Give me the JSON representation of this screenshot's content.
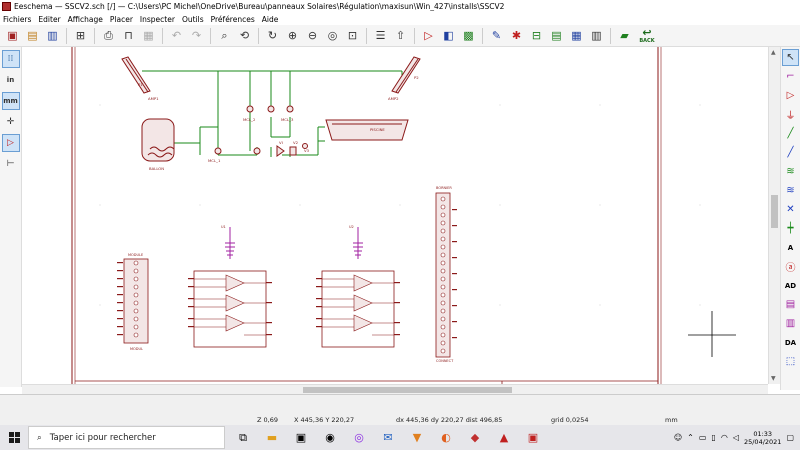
{
  "window": {
    "title": "Eeschema — SSCV2.sch [/] — C:\\Users\\PC Michel\\OneDrive\\Bureau\\panneaux Solaires\\Régulation\\maxisun\\Win_427\\installs\\SSCV2"
  },
  "menu": [
    "Fichiers",
    "Editer",
    "Affichage",
    "Placer",
    "Inspecter",
    "Outils",
    "Préférences",
    "Aide"
  ],
  "toolbar": {
    "back_label": "BACK"
  },
  "left_toolbar": {
    "unit_in": "in",
    "unit_mm": "mm"
  },
  "right_toolbar": {
    "label_a": "A",
    "label_ad": "AD",
    "label_da": "DA"
  },
  "schematic": {
    "labels": {
      "p1": "P1",
      "p2": "P2",
      "ap1": "AMP1",
      "ap2": "AMP2",
      "ballon": "BALLON",
      "piscine": "PISCINE",
      "pump_left": "MCL_1",
      "pump_a": "MCL_2",
      "pump_b": "MCL_3",
      "v1": "VI",
      "v2": "V2",
      "v3": "V3",
      "mod_left_title": "MODULE",
      "mod_left_bottom": "MODUL",
      "u1": "U1",
      "u2": "U2",
      "conn_right_title": "BORNIER",
      "conn_right_bottom": "CONNECT"
    }
  },
  "status": {
    "zoom": "Z 0,69",
    "xy": "X 445,36  Y 220,27",
    "delta": "dx 445,36  dy 220,27  dist 496,85",
    "grid": "grid 0,0254",
    "units": "mm"
  },
  "taskbar": {
    "search_placeholder": "Taper ici pour rechercher",
    "time": "01:33",
    "date": "25/04/2021"
  }
}
